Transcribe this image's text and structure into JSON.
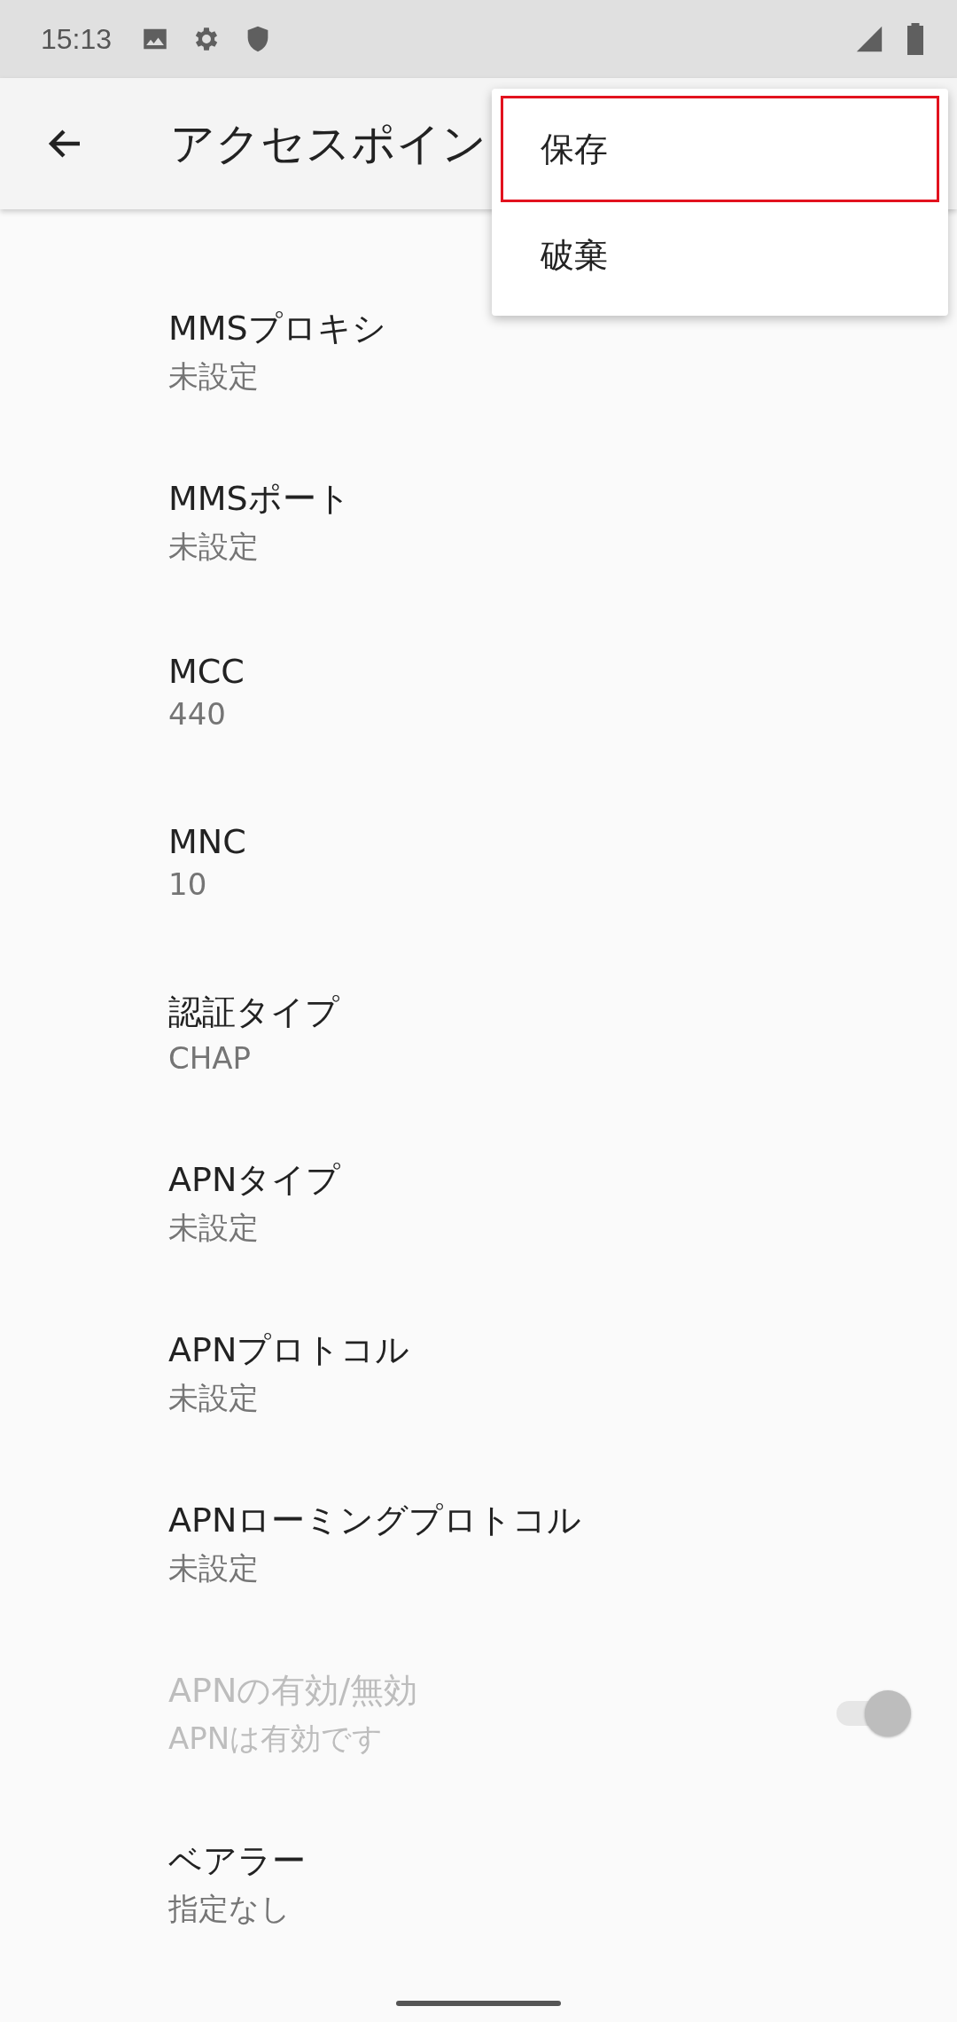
{
  "status_bar": {
    "time": "15:13"
  },
  "app_bar": {
    "title": "アクセスポイン"
  },
  "menu": [
    {
      "label": "保存",
      "selected": true
    },
    {
      "label": "破棄",
      "selected": false
    }
  ],
  "settings": [
    {
      "kind": "text",
      "title": "MMSプロキシ",
      "value": "未設定",
      "disabled": false
    },
    {
      "kind": "text",
      "title": "MMSポート",
      "value": "未設定",
      "disabled": false
    },
    {
      "kind": "text",
      "title": "MCC",
      "value": "440",
      "disabled": false
    },
    {
      "kind": "text",
      "title": "MNC",
      "value": "10",
      "disabled": false
    },
    {
      "kind": "text",
      "title": "認証タイプ",
      "value": "CHAP",
      "disabled": false
    },
    {
      "kind": "text",
      "title": "APNタイプ",
      "value": "未設定",
      "disabled": false
    },
    {
      "kind": "text",
      "title": "APNプロトコル",
      "value": "未設定",
      "disabled": false
    },
    {
      "kind": "text",
      "title": "APNローミングプロトコル",
      "value": "未設定",
      "disabled": false
    },
    {
      "kind": "switch",
      "title": "APNの有効/無効",
      "value": "APNは有効です",
      "disabled": true,
      "on": true
    },
    {
      "kind": "text",
      "title": "ベアラー",
      "value": "指定なし",
      "disabled": false
    }
  ]
}
